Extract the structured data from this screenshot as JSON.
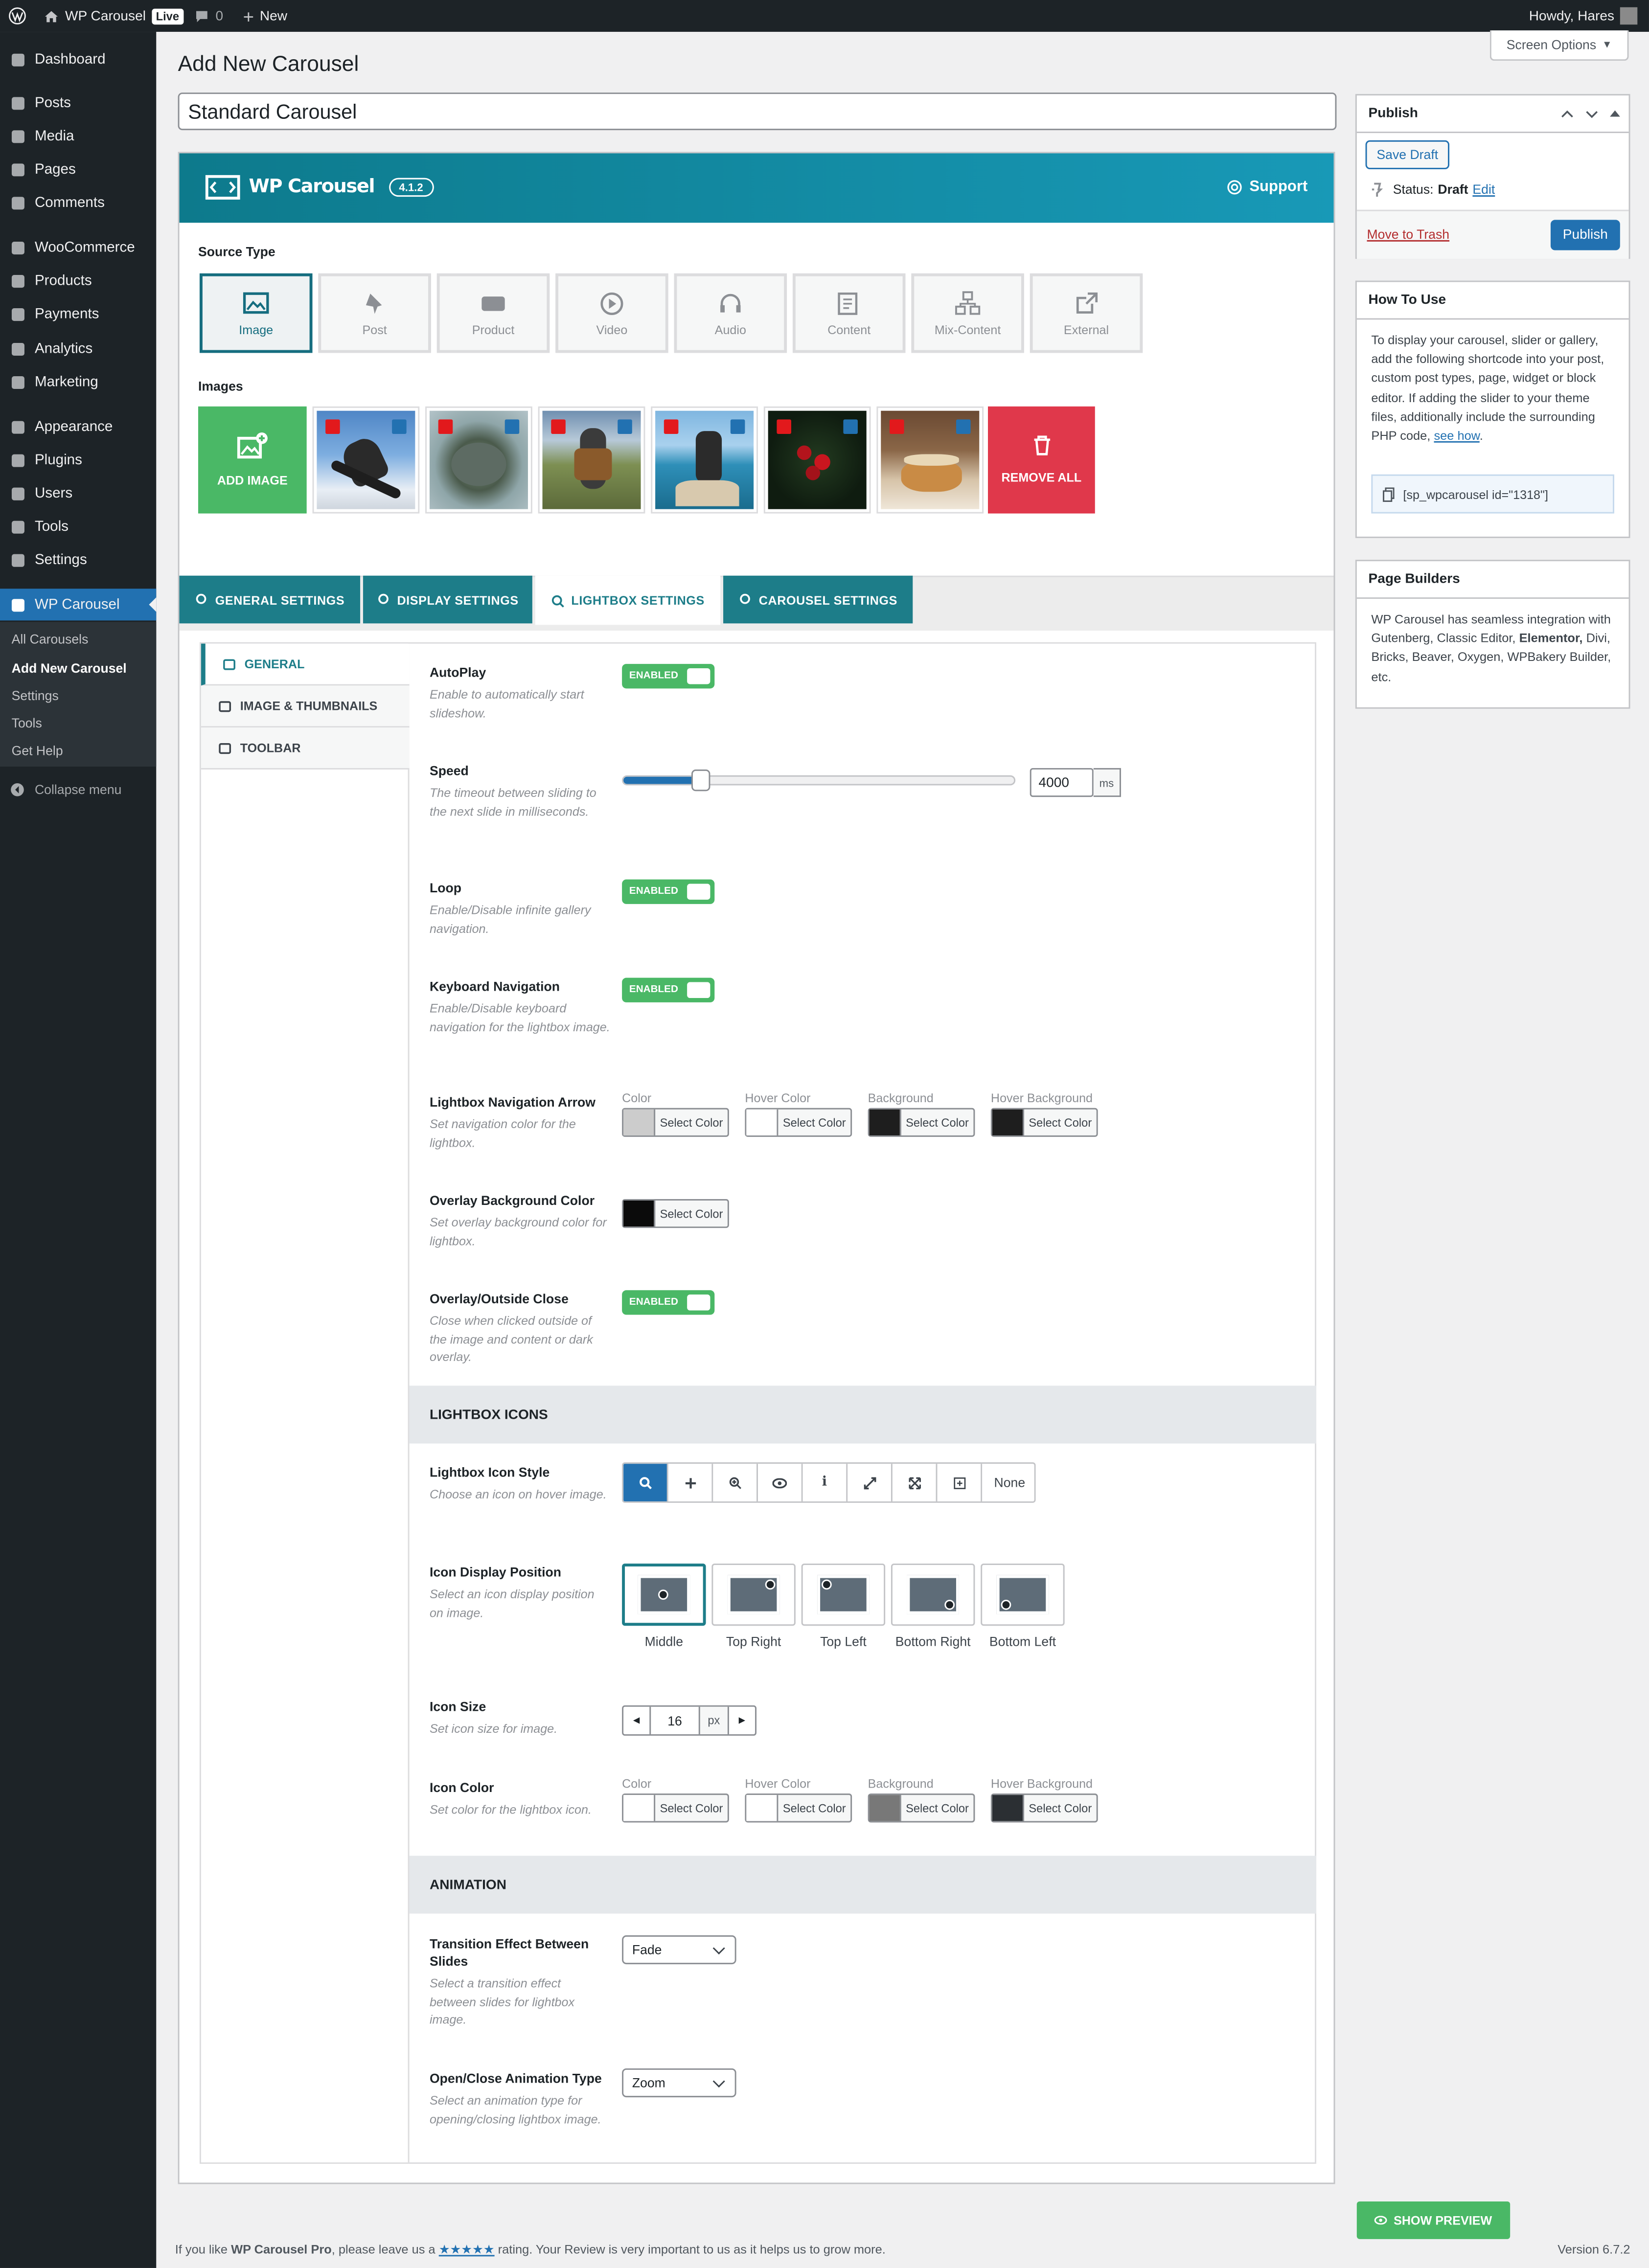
{
  "admin_bar": {
    "site_name": "WP Carousel",
    "live_badge": "Live",
    "comments_count": "0",
    "new_label": "New",
    "greeting": "Howdy, Hares"
  },
  "side_menu": {
    "items": [
      {
        "label": "Dashboard",
        "icon": "dashboard-icon"
      },
      {
        "label": "Posts",
        "icon": "pin-icon"
      },
      {
        "label": "Media",
        "icon": "media-icon"
      },
      {
        "label": "Pages",
        "icon": "pages-icon"
      },
      {
        "label": "Comments",
        "icon": "comment-icon"
      },
      {
        "label": "WooCommerce",
        "icon": "woocommerce-icon"
      },
      {
        "label": "Products",
        "icon": "archive-icon"
      },
      {
        "label": "Payments",
        "icon": "dollar-icon"
      },
      {
        "label": "Analytics",
        "icon": "chart-bar-icon"
      },
      {
        "label": "Marketing",
        "icon": "megaphone-icon"
      },
      {
        "label": "Appearance",
        "icon": "brush-icon"
      },
      {
        "label": "Plugins",
        "icon": "plugin-icon"
      },
      {
        "label": "Users",
        "icon": "users-icon"
      },
      {
        "label": "Tools",
        "icon": "wrench-icon"
      },
      {
        "label": "Settings",
        "icon": "settings-icon"
      },
      {
        "label": "WP Carousel",
        "icon": "carousel-icon"
      }
    ],
    "submenu": [
      "All Carousels",
      "Add New Carousel",
      "Settings",
      "Tools",
      "Get Help"
    ],
    "collapse_label": "Collapse menu"
  },
  "page": {
    "title": "Add New Carousel",
    "screen_options": "Screen Options",
    "post_title_value": "Standard Carousel"
  },
  "plugin_header": {
    "logo_text": "WP Carousel",
    "version": "4.1.2",
    "support_label": "Support"
  },
  "source_type": {
    "label": "Source Type",
    "options": [
      "Image",
      "Post",
      "Product",
      "Video",
      "Audio",
      "Content",
      "Mix-Content",
      "External"
    ],
    "selected": "Image"
  },
  "images": {
    "label": "Images",
    "add_label": "ADD IMAGE",
    "remove_all_label": "REMOVE ALL"
  },
  "settings_tabs": [
    "GENERAL SETTINGS",
    "DISPLAY SETTINGS",
    "LIGHTBOX SETTINGS",
    "CAROUSEL SETTINGS"
  ],
  "selected_settings_tab": "LIGHTBOX SETTINGS",
  "lightbox_tabs": [
    "GENERAL",
    "IMAGE & THUMBNAILS",
    "TOOLBAR"
  ],
  "fields": {
    "autoplay": {
      "title": "AutoPlay",
      "desc": "Enable to automatically start slideshow.",
      "state": "ENABLED"
    },
    "speed": {
      "title": "Speed",
      "desc": "The timeout between sliding to the next slide in milliseconds.",
      "value": "4000",
      "unit": "ms",
      "slider_fraction": 0.2
    },
    "loop": {
      "title": "Loop",
      "desc": "Enable/Disable infinite gallery navigation.",
      "state": "ENABLED"
    },
    "keyboard": {
      "title": "Keyboard Navigation",
      "desc": "Enable/Disable keyboard navigation for the lightbox image.",
      "state": "ENABLED"
    },
    "nav_arrow": {
      "title": "Lightbox Navigation Arrow",
      "desc": "Set navigation color for the lightbox.",
      "colors": [
        {
          "label": "Color",
          "swatch": "#cccccc"
        },
        {
          "label": "Hover Color",
          "swatch": "#ffffff"
        },
        {
          "label": "Background",
          "swatch": "#1e1e1e"
        },
        {
          "label": "Hover Background",
          "swatch": "#1e1e1e"
        }
      ]
    },
    "overlay_bg": {
      "title": "Overlay Background Color",
      "desc": "Set overlay background color for lightbox.",
      "swatch": "#0b0b0b"
    },
    "overlay_close": {
      "title": "Overlay/Outside Close",
      "desc": "Close when clicked outside of the image and content or dark overlay.",
      "state": "ENABLED"
    },
    "icons_section": "LIGHTBOX ICONS",
    "icon_style": {
      "title": "Lightbox Icon Style",
      "desc": "Choose an icon on hover image.",
      "options": [
        "search-icon",
        "plus-icon",
        "zoom-in-icon",
        "eye-icon",
        "info-icon",
        "expand-icon",
        "arrows-out-icon",
        "plus-square-icon"
      ],
      "none_label": "None"
    },
    "icon_position": {
      "title": "Icon Display Position",
      "desc": "Select an icon display position on image.",
      "options": [
        "Middle",
        "Top Right",
        "Top Left",
        "Bottom Right",
        "Bottom Left"
      ],
      "selected": "Middle"
    },
    "icon_size": {
      "title": "Icon Size",
      "desc": "Set icon size for image.",
      "value": "16",
      "unit": "px"
    },
    "icon_color": {
      "title": "Icon Color",
      "desc": "Set color for the lightbox icon.",
      "colors": [
        {
          "label": "Color",
          "swatch": "#ffffff"
        },
        {
          "label": "Hover Color",
          "swatch": "#ffffff"
        },
        {
          "label": "Background",
          "swatch": "#787878"
        },
        {
          "label": "Hover Background",
          "swatch": "#2b2f33"
        }
      ]
    },
    "animation_section": "ANIMATION",
    "transition": {
      "title": "Transition Effect Between Slides",
      "desc": "Select a transition effect between slides for lightbox image.",
      "value": "Fade"
    },
    "open_close": {
      "title": "Open/Close Animation Type",
      "desc": "Select an animation type for opening/closing lightbox image.",
      "value": "Zoom"
    }
  },
  "color_button_label": "Select Color",
  "publish_box": {
    "title": "Publish",
    "save_draft": "Save Draft",
    "status_label": "Status:",
    "status_value": "Draft",
    "edit_link": "Edit",
    "trash_link": "Move to Trash",
    "publish_button": "Publish"
  },
  "how_to_use": {
    "title": "How To Use",
    "text": "To display your carousel, slider or gallery, add the following shortcode into your post, custom post types, page, widget or block editor. If adding the slider to your theme files, additionally include the surrounding PHP code,",
    "link": "see how",
    "shortcode": "[sp_wpcarousel id=\"1318\"]"
  },
  "page_builders": {
    "title": "Page Builders",
    "text_a": "WP Carousel has seamless integration with Gutenberg, Classic Editor,",
    "bold": "Elementor,",
    "text_b": "Divi, Bricks, Beaver, Oxygen, WPBakery Builder, etc."
  },
  "show_preview": "SHOW PREVIEW",
  "footer": {
    "text_a": "If you like",
    "bold": "WP Carousel Pro",
    "text_b": ", please leave us a",
    "stars": "★★★★★",
    "text_c": "rating. Your Review is very important to us as it helps us to grow more.",
    "version": "Version 6.7.2"
  },
  "colors": {
    "accent": "#1d7d89",
    "wp_blue": "#2271b1",
    "enabled_green": "#4ab866",
    "remove_red": "#e0384b"
  }
}
